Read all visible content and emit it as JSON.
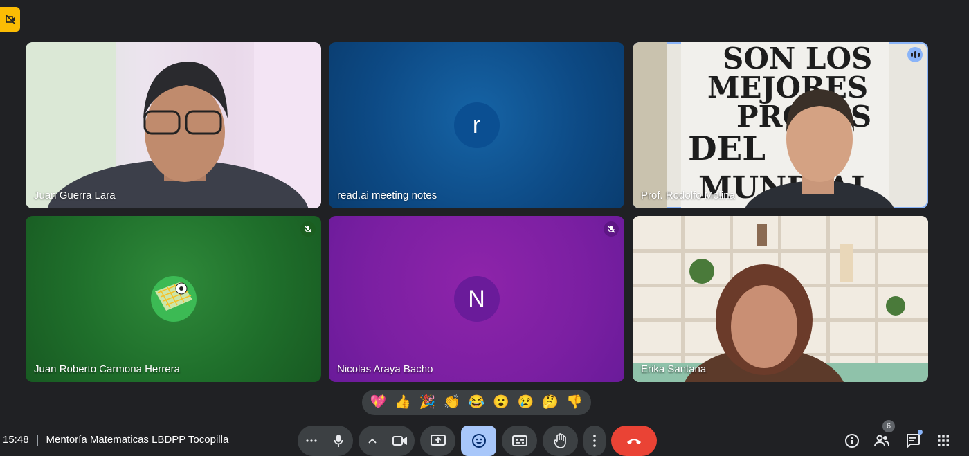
{
  "meeting": {
    "time": "15:48",
    "title": "Mentoría Matematicas LBDPP Tocopilla"
  },
  "tiles": [
    {
      "name": "Juan Guerra Lara"
    },
    {
      "name": "read.ai meeting notes",
      "initial": "r",
      "avatar_color": "#0b4f92"
    },
    {
      "name": "Prof. Rodolfo Molina",
      "backdrop_text": [
        "SON LOS",
        "MEJORES",
        "PROFES",
        "DEL",
        "MUNDIAL"
      ]
    },
    {
      "name": "Juan Roberto Carmona Herrera",
      "avatar_icon": "soccer-goal-icon"
    },
    {
      "name": "Nicolas Araya Bacho",
      "initial": "N",
      "avatar_color": "#7b1fa2"
    },
    {
      "name": "Erika Santana"
    }
  ],
  "reactions": [
    "💖",
    "👍",
    "🎉",
    "👏",
    "😂",
    "😮",
    "😢",
    "🤔",
    "👎"
  ],
  "participants_count": "6",
  "colors": {
    "end_call": "#ea4335",
    "reactions_active": "#a8c7fa",
    "badge": "#fbbc04"
  }
}
